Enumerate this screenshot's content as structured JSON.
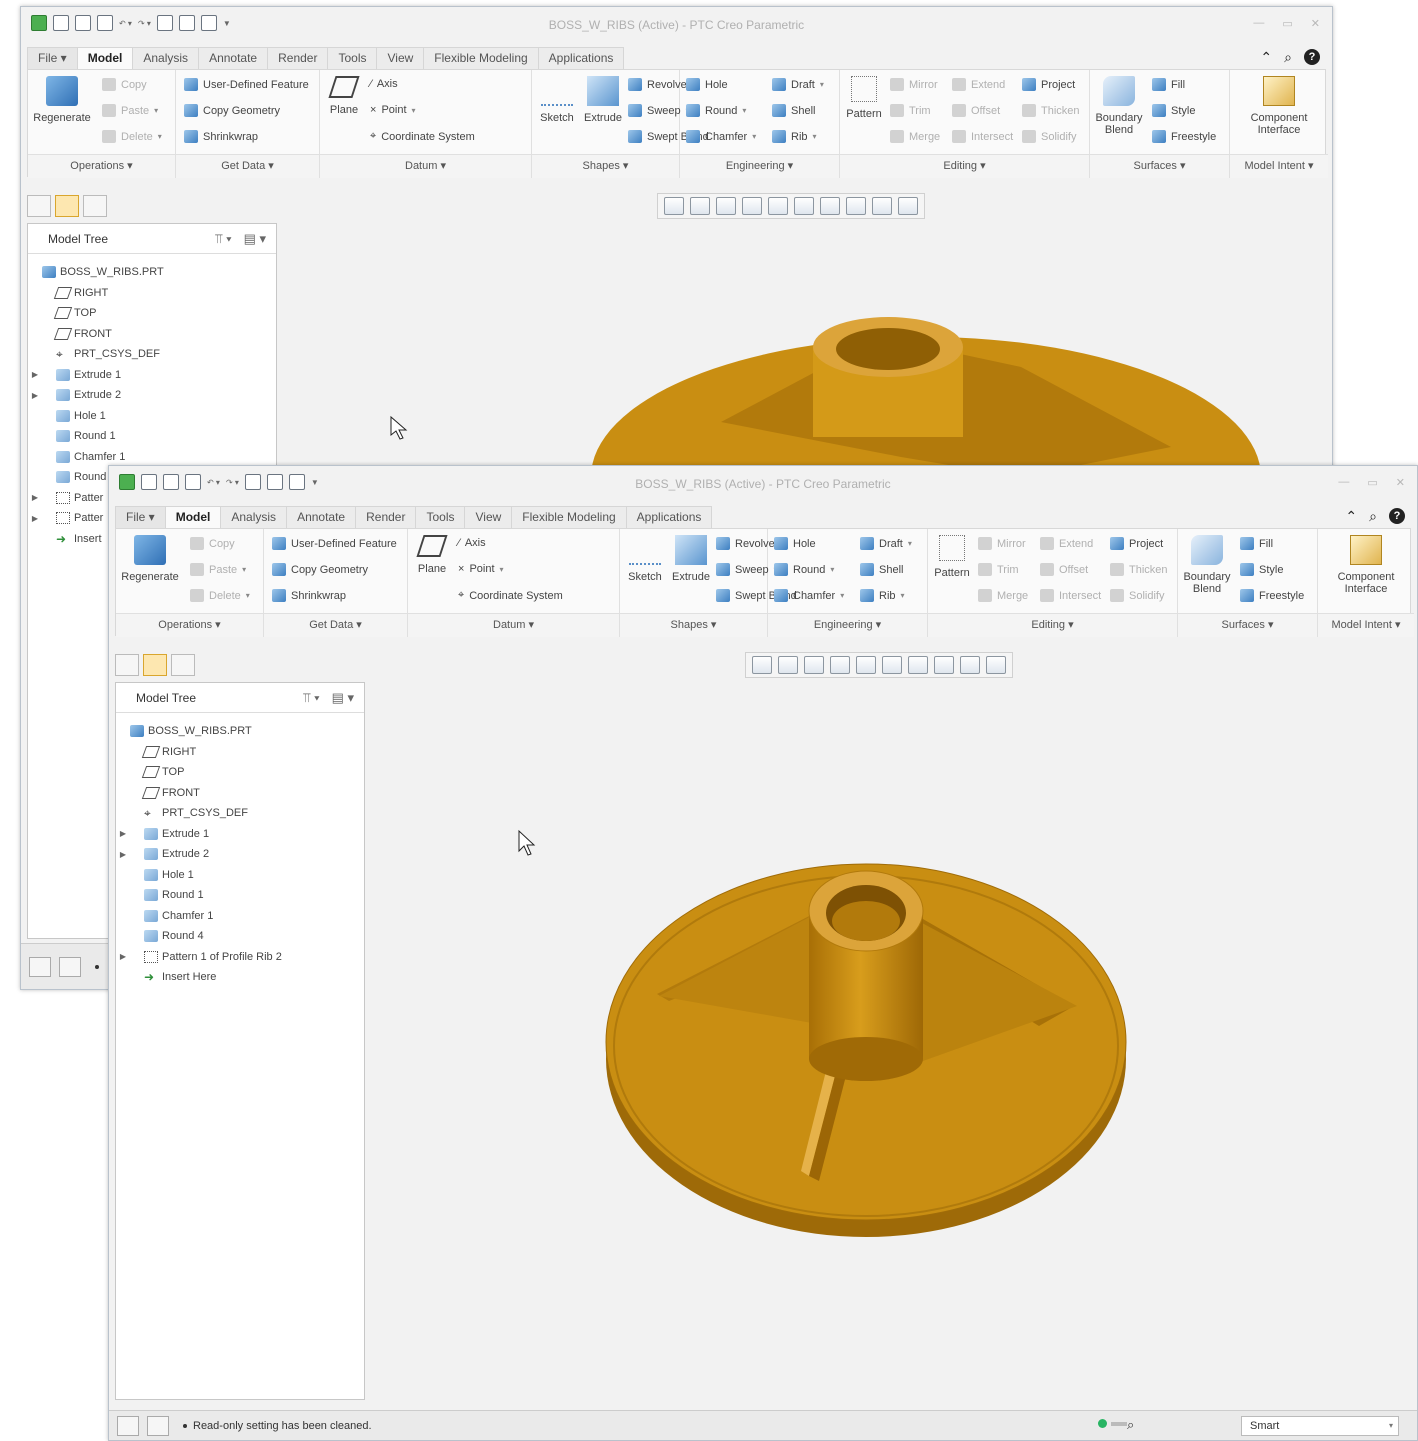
{
  "window": {
    "title": "BOSS_W_RIBS (Active) - PTC Creo Parametric"
  },
  "tabs": [
    "File",
    "Model",
    "Analysis",
    "Annotate",
    "Render",
    "Tools",
    "View",
    "Flexible Modeling",
    "Applications"
  ],
  "ribbon": {
    "operations": {
      "regenerate": "Regenerate",
      "copy": "Copy",
      "paste": "Paste",
      "delete": "Delete",
      "label": "Operations"
    },
    "get_data": {
      "udf": "User-Defined Feature",
      "copy_geometry": "Copy Geometry",
      "shrinkwrap": "Shrinkwrap",
      "label": "Get Data"
    },
    "datum": {
      "plane": "Plane",
      "axis": "Axis",
      "point": "Point",
      "csys": "Coordinate System",
      "label": "Datum"
    },
    "shapes": {
      "sketch": "Sketch",
      "extrude": "Extrude",
      "revolve": "Revolve",
      "sweep": "Sweep",
      "swept_blend": "Swept Blend",
      "label": "Shapes"
    },
    "engineering": {
      "hole": "Hole",
      "round": "Round",
      "chamfer": "Chamfer",
      "draft": "Draft",
      "shell": "Shell",
      "rib": "Rib",
      "label": "Engineering"
    },
    "editing": {
      "pattern": "Pattern",
      "mirror": "Mirror",
      "trim": "Trim",
      "merge": "Merge",
      "extend": "Extend",
      "offset": "Offset",
      "intersect": "Intersect",
      "project": "Project",
      "thicken": "Thicken",
      "solidify": "Solidify",
      "label": "Editing"
    },
    "surfaces": {
      "boundary_blend_1": "Boundary",
      "boundary_blend_2": "Blend",
      "fill": "Fill",
      "style": "Style",
      "freestyle": "Freestyle",
      "label": "Surfaces"
    },
    "model_intent": {
      "component_1": "Component",
      "component_2": "Interface",
      "label": "Model Intent"
    }
  },
  "model_tree": {
    "header": "Model Tree",
    "back_items": [
      "BOSS_W_RIBS.PRT",
      "RIGHT",
      "TOP",
      "FRONT",
      "PRT_CSYS_DEF",
      "Extrude 1",
      "Extrude 2",
      "Hole 1",
      "Round 1",
      "Chamfer 1",
      "Round",
      "Patter",
      "Patter",
      "Insert"
    ],
    "front_items": [
      "BOSS_W_RIBS.PRT",
      "RIGHT",
      "TOP",
      "FRONT",
      "PRT_CSYS_DEF",
      "Extrude 1",
      "Extrude 2",
      "Hole 1",
      "Round 1",
      "Chamfer 1",
      "Round 4",
      "Pattern 1 of Profile Rib 2",
      "Insert Here"
    ]
  },
  "status": {
    "message": "Read-only setting has been cleaned.",
    "filter": "Smart"
  },
  "icons": {
    "search": "search-icon",
    "help": "help-icon",
    "model_color": "#c9900f"
  }
}
